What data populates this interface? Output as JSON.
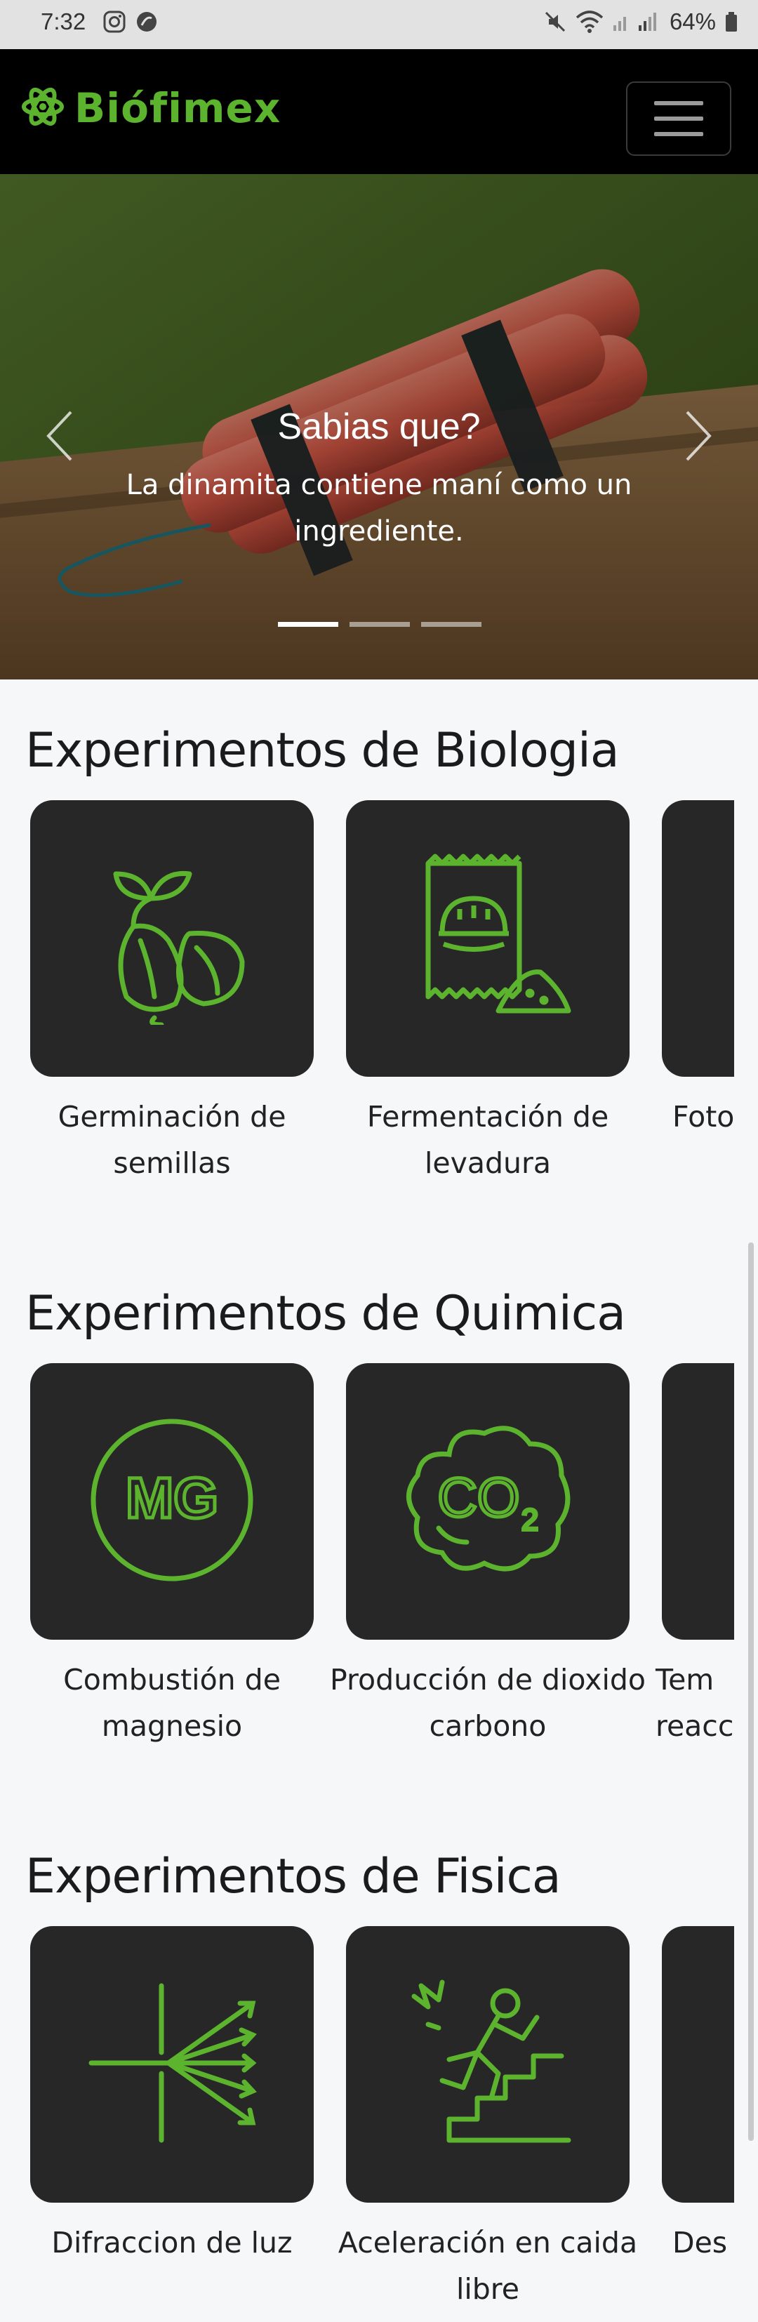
{
  "status_bar": {
    "time": "7:32",
    "battery": "64%"
  },
  "navbar": {
    "brand": "Biófimex",
    "menu_icon": "hamburger-icon"
  },
  "carousel": {
    "title": "Sabias que?",
    "text": "La dinamita contiene maní como un ingrediente.",
    "slides": 3,
    "active_slide": 1
  },
  "sections": [
    {
      "title": "Experimentos de Biologia",
      "cards": [
        {
          "label": "Germinación de semillas",
          "icon": "seed-sprout-icon"
        },
        {
          "label": "Fermentación de levadura",
          "icon": "yeast-bread-icon"
        },
        {
          "label": "Foto",
          "icon": ""
        }
      ]
    },
    {
      "title": "Experimentos de Quimica",
      "cards": [
        {
          "label": "Combustión de magnesio",
          "icon": "magnesium-icon"
        },
        {
          "label": "Producción de dioxido carbono",
          "icon": "co2-cloud-icon"
        },
        {
          "label": "Tem reacc",
          "icon": ""
        }
      ]
    },
    {
      "title": "Experimentos de Fisica",
      "cards": [
        {
          "label": "Difraccion de luz",
          "icon": "light-diffraction-icon"
        },
        {
          "label": "Aceleración en caida libre",
          "icon": "falling-person-icon"
        },
        {
          "label": "Des",
          "icon": ""
        }
      ]
    }
  ],
  "colors": {
    "accent": "#5cb32e",
    "card_bg": "#272727",
    "navbar_bg": "#000000"
  }
}
